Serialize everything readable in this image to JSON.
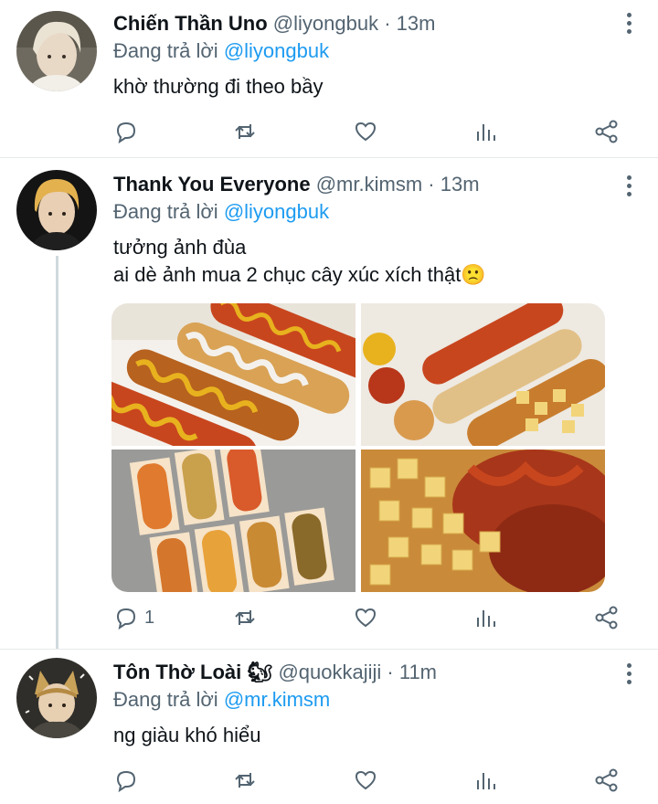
{
  "tweets": [
    {
      "name": "Chiến Thần Uno",
      "handle": "@liyongbuk",
      "time": "· 13m",
      "reply_prefix": "Đang trả lời ",
      "reply_to": "@liyongbuk",
      "lines": [
        "khờ thường đi theo bầy"
      ],
      "replies": "",
      "avatar_colors": [
        "#d9d2c4",
        "#8a7f6c"
      ]
    },
    {
      "name": "Thank You Everyone",
      "handle": "@mr.kimsm",
      "time": "· 13m",
      "reply_prefix": "Đang trả lời ",
      "reply_to": "@liyongbuk",
      "lines": [
        "tưởng ảnh đùa",
        "ai dè ảnh mua 2 chục cây xúc xích thật🙁"
      ],
      "replies": "1",
      "avatar_colors": [
        "#1a1a1a",
        "#e8b95a"
      ]
    },
    {
      "name": "Tôn Thờ Loài 🐿",
      "handle": "@quokkajiji",
      "time": "· 11m",
      "reply_prefix": "Đang trả lời ",
      "reply_to": "@mr.kimsm",
      "lines": [
        "ng giàu khó hiểu"
      ],
      "replies": "",
      "avatar_colors": [
        "#3b3a36",
        "#c9a25a"
      ]
    }
  ],
  "media": {
    "photos": [
      "corn-dog-tray",
      "corn-dog-box",
      "corn-dog-boxes",
      "potato-corn-dog"
    ],
    "colors": {
      "sauce": "#c8461e",
      "mustard": "#e8b21e",
      "batter": "#d9a255",
      "paper": "#f4f1ec"
    }
  },
  "colors": {
    "link": "#1d9bf0",
    "muted": "#536471"
  },
  "icons": [
    "reply-icon",
    "retweet-icon",
    "like-icon",
    "analytics-icon",
    "share-icon",
    "more-icon"
  ]
}
